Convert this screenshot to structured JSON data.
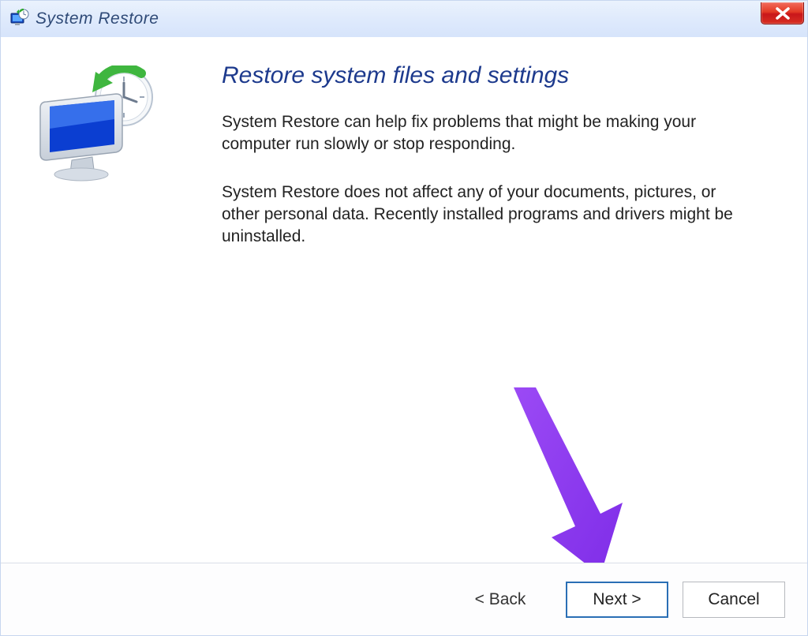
{
  "window": {
    "title": "System Restore"
  },
  "content": {
    "heading": "Restore system files and settings",
    "paragraph1": "System Restore can help fix problems that might be making your computer run slowly or stop responding.",
    "paragraph2": "System Restore does not affect any of your documents, pictures, or other personal data. Recently installed programs and drivers might be uninstalled."
  },
  "footer": {
    "back_label": "< Back",
    "next_label": "Next >",
    "cancel_label": "Cancel"
  },
  "colors": {
    "heading": "#1d3a8d",
    "accent_arrow": "#8d3cf3"
  }
}
